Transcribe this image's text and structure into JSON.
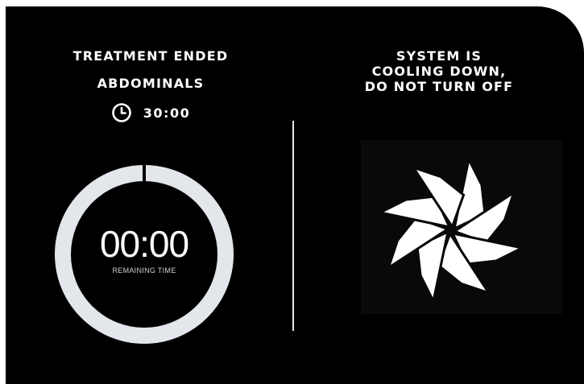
{
  "status_title": "TREATMENT ENDED",
  "treatment_area": "ABDOMINALS",
  "duration": {
    "icon": "clock-icon",
    "value": "30:00"
  },
  "timer": {
    "value": "00:00",
    "label": "REMAINING TIME",
    "remaining_fraction": 0,
    "ring_color": "#e3e7ec"
  },
  "system_message": {
    "lines": [
      "SYSTEM IS",
      "COOLING DOWN,",
      "DO NOT TURN OFF"
    ]
  },
  "cooling_icon": "snowflake-icon",
  "colors": {
    "background": "#000000",
    "text": "#ffffff"
  }
}
